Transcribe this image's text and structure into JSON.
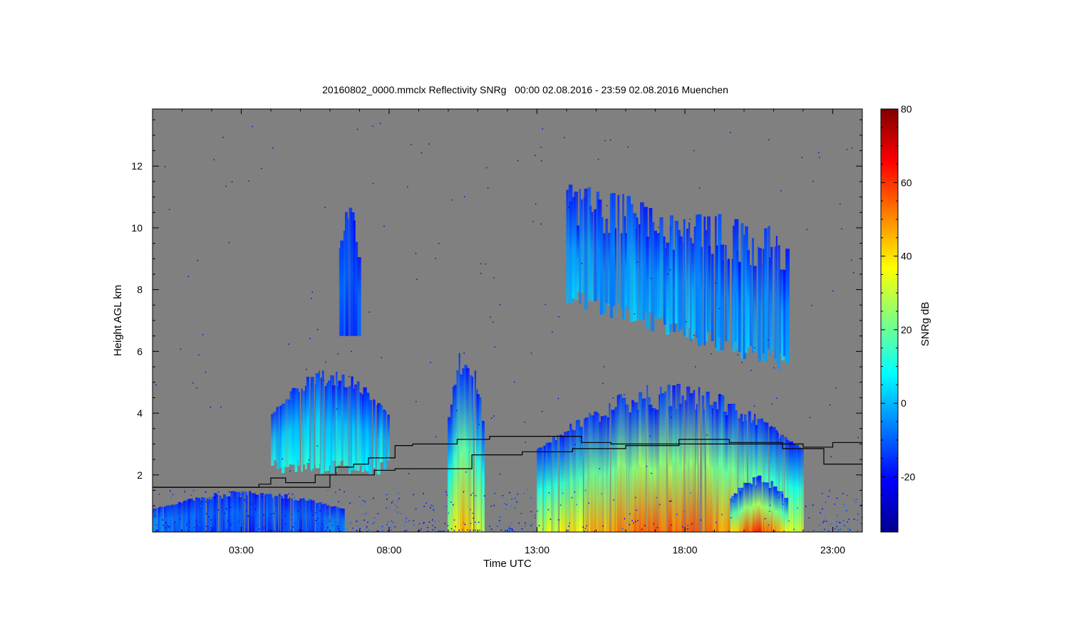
{
  "chart_data": {
    "type": "heatmap",
    "title": "20160802_0000.mmclx Reflectivity SNRg   00:00 02.08.2016 - 23:59 02.08.2016 Muenchen",
    "xlabel": "Time UTC",
    "ylabel": "Height AGL km",
    "x_unit": "hours UTC",
    "xlim": [
      0,
      24
    ],
    "ylim": [
      0.15,
      13.85
    ],
    "x_ticks": [
      3,
      8,
      13,
      18,
      23
    ],
    "x_tick_labels": [
      "03:00",
      "08:00",
      "13:00",
      "18:00",
      "23:00"
    ],
    "y_ticks": [
      2,
      4,
      6,
      8,
      10,
      12
    ],
    "y_tick_labels": [
      "2",
      "4",
      "6",
      "8",
      "10",
      "12"
    ],
    "background_color": "#808080",
    "colorbar": {
      "label": "SNRg dB",
      "range": [
        -35,
        80
      ],
      "ticks": [
        -20,
        0,
        20,
        40,
        60,
        80
      ],
      "tick_labels": [
        "-20",
        "0",
        "20",
        "40",
        "60",
        "80"
      ],
      "colormap": "jet",
      "colors": [
        "#00008f",
        "#0000ff",
        "#0080ff",
        "#00ffff",
        "#80ff80",
        "#ffff00",
        "#ff8000",
        "#ff0000",
        "#800000"
      ]
    },
    "echo_regions": [
      {
        "name": "morning low clutter",
        "time_range": [
          0,
          6.5
        ],
        "height_range": [
          0.15,
          1.5
        ],
        "peak_snr": -15
      },
      {
        "name": "mid-level cloud 05-08",
        "time_range": [
          4,
          8
        ],
        "height_range": [
          2,
          5.5
        ],
        "peak_snr": 10
      },
      {
        "name": "fall streak 06:30",
        "time_range": [
          6.3,
          7
        ],
        "height_range": [
          6.5,
          11
        ],
        "peak_snr": -15
      },
      {
        "name": "convective column 10:30",
        "time_range": [
          10,
          11.2
        ],
        "height_range": [
          0.15,
          6.5
        ],
        "peak_snr": 45
      },
      {
        "name": "cirrus shield",
        "time_range": [
          14,
          21.5
        ],
        "height_range": [
          5.3,
          11.5
        ],
        "peak_snr": 0
      },
      {
        "name": "afternoon precipitation",
        "time_range": [
          13,
          22
        ],
        "height_range": [
          0.15,
          5
        ],
        "peak_snr": 55
      },
      {
        "name": "evening rain core",
        "time_range": [
          19.5,
          21.5
        ],
        "height_range": [
          0.15,
          2
        ],
        "peak_snr": 60
      }
    ],
    "series": [
      {
        "type": "step",
        "x": [
          0,
          2.2,
          3.2,
          3.6,
          4,
          4.5,
          5.5,
          6.2,
          6.8,
          7.3,
          8.2,
          8.8,
          10.3,
          11.4,
          14.5,
          15.5,
          17,
          18.8,
          21,
          22,
          23,
          24
        ],
        "values": [
          1.6,
          1.6,
          1.6,
          1.7,
          1.9,
          1.75,
          2.0,
          2.25,
          2.35,
          2.55,
          2.95,
          3.0,
          3.15,
          3.25,
          3.05,
          3.0,
          3.0,
          3.0,
          3.0,
          2.9,
          3.05,
          3.05
        ]
      },
      {
        "type": "step",
        "x": [
          0,
          6,
          7.5,
          8.2,
          9.5,
          10.8,
          12.5,
          14.2,
          16,
          17.8,
          19.5,
          21.3,
          22.7,
          24
        ],
        "values": [
          1.6,
          2.0,
          2.15,
          2.2,
          2.2,
          2.65,
          2.75,
          2.85,
          2.95,
          3.15,
          3.05,
          2.85,
          2.35,
          2.35
        ]
      }
    ]
  }
}
